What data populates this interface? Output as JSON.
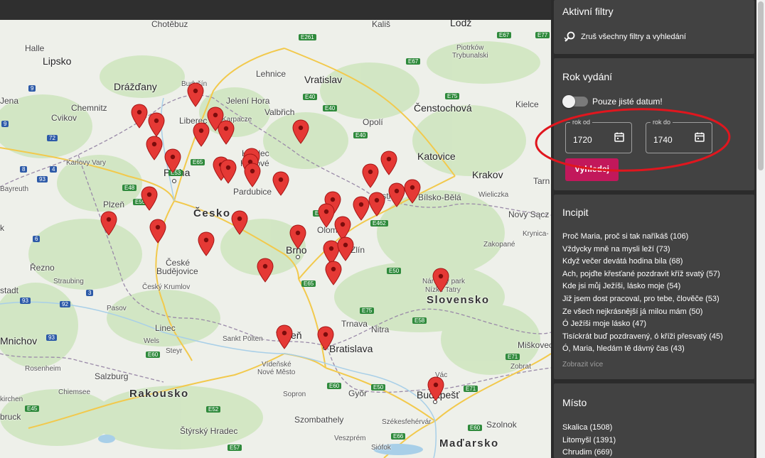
{
  "map": {
    "labels": {
      "halle": "Halle",
      "lipsko": "Lipsko",
      "jena": "Jena",
      "chemnitz": "Chemnitz",
      "drazdany": "Drážďany",
      "cvikov": "Cvikov",
      "karlovy_vary": "Karlovy Vary",
      "bayreuth": "Bayreuth",
      "plzen": "Plzeň",
      "praha": "Praha",
      "liberec": "Liberec",
      "jelenia_hora": "Jelení Hora",
      "karpacze": "Karpacze",
      "valbrich": "Valbřich",
      "lehnice": "Lehnice",
      "vratislav": "Vratislav",
      "opoli": "Opolí",
      "censtochova": "Čenstochová",
      "kielce": "Kielce",
      "katovice": "Katovice",
      "krakov": "Krakov",
      "wieliczka": "Wieliczka",
      "bielsko": "Bílsko-Bělá",
      "novy_sacz": "Nový Sącz",
      "krynica": "Krynica-",
      "zakopane": "Zakopané",
      "tarn": "Tarn",
      "hradec_top": "Hr",
      "hradec": "Hradec",
      "kralove": "Králové",
      "pardubice": "Pardubice",
      "cesko": "Česko",
      "olomouc": "Olom",
      "zlin": "Zlín",
      "ostrava": "Ostr",
      "brno": "Brno",
      "ceske": "České",
      "budejovice": "Budějovice",
      "cesky_krumlov": "Český Krumlov",
      "rezno": "Řezno",
      "straubing": "Straubing",
      "stadt": "stadt",
      "pasov": "Pasov",
      "linec": "Linec",
      "wels": "Wels",
      "steyr": "Steyr",
      "sankt_polten": "Sankt Pölten",
      "viden": "Vídeň",
      "trnava": "Trnava",
      "nitra": "Nitra",
      "bratislava": "Bratislava",
      "slovensko": "Slovensko",
      "narodny": "Národný park",
      "nizke_tatry": "Nízke Tatry",
      "miskovec": "Miškovec",
      "mnichov": "Mnichov",
      "rosenheim": "Rosenheim",
      "salzburg": "Salzburg",
      "rakousko": "Rakousko",
      "videnske": "Vídeňské",
      "nove_mesto": "Nové Město",
      "sopron": "Sopron",
      "gyor": "Győr",
      "vac": "Vác",
      "budapest": "Budapešť",
      "zebrat": "Zobrat",
      "szolnok": "Szolnok",
      "szekesfehervar": "Székesfehérvár",
      "szombathely": "Szombathely",
      "veszprem": "Veszprém",
      "siofok": "Siófok",
      "madarsko": "Maďarsko",
      "styrsky_hradec": "Štýrský Hradec",
      "chiemsee": "Chiemsee",
      "kirchen": "kirchen",
      "bruck": "bruck",
      "chotebuz": "Chotěbuz",
      "budysin": "Budyšín",
      "kalis": "Kališ",
      "lodz": "Lodž",
      "piotrkow": "Piotrków",
      "trybunalski": "Trybunalski",
      "k_left": "k"
    },
    "shields": [
      "E261",
      "E67",
      "E77",
      "E67",
      "E75",
      "E40",
      "E40",
      "E40",
      "E48",
      "E55",
      "E65",
      "E50",
      "E462",
      "E65",
      "E50",
      "E75",
      "E58",
      "E50",
      "E71",
      "E71",
      "E60",
      "E60",
      "E66",
      "E45",
      "E60",
      "E52",
      "E53",
      "E57"
    ],
    "blue_shields": [
      "9",
      "9",
      "4",
      "72",
      "6",
      "93",
      "92",
      "3",
      "8",
      "93",
      "93"
    ]
  },
  "panel": {
    "active_filters": {
      "title": "Aktivní filtry",
      "clear_label": "Zruš všechny filtry a vyhledání"
    },
    "year": {
      "title": "Rok vydání",
      "toggle_label": "Pouze jisté datum!",
      "toggle_on": false,
      "from_label": "rok od",
      "from_value": "1720",
      "to_label": "rok do",
      "to_value": "1740",
      "search_label": "Vyhledej"
    },
    "incipit": {
      "title": "Incipit",
      "items": [
        "Proč Maria, proč si tak naříkáš (106)",
        "Vždycky mně na mysli leží (73)",
        "Když večer devátá hodina bila (68)",
        "Ach, pojďte křesťané pozdravit kříž svatý (57)",
        "Kde jsi můj Ježíši, lásko moje (54)",
        "Již jsem dost pracoval, pro tebe, člověče (53)",
        "Ze všech nejkrásnější já milou mám (50)",
        "Ó Ježíši moje lásko (47)",
        "Tisíckrát buď pozdravený, ó kříži přesvatý (45)",
        "Ó, Maria, hledám tě dávný čas (43)"
      ],
      "more_label": "Zobrazit více"
    },
    "place": {
      "title": "Místo",
      "items": [
        "Skalica (1508)",
        "Litomyšl (1391)",
        "Chrudim (669)"
      ]
    }
  },
  "colors": {
    "panel_bg": "#2b2b2b",
    "card_bg": "#424242",
    "accent": "#c2185b",
    "pin": "#e53935",
    "annotation": "#e0161e"
  }
}
